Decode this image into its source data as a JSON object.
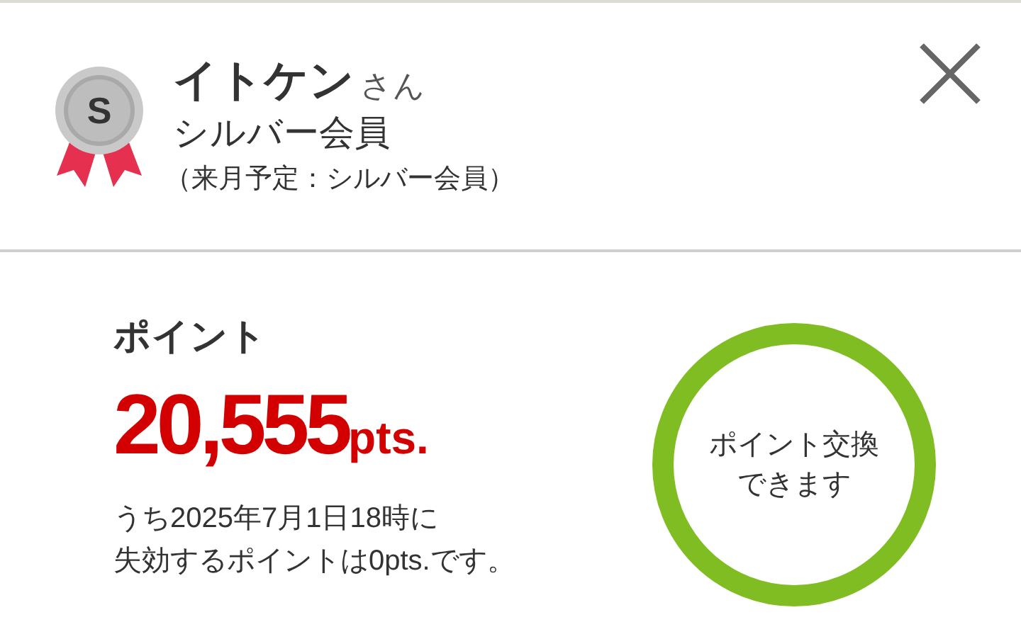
{
  "member": {
    "badge_letter": "S",
    "name": "イトケン",
    "honorific": "さん",
    "rank": "シルバー会員",
    "next_rank_note": "（来月予定：シルバー会員）"
  },
  "points": {
    "label": "ポイント",
    "value": "20,555",
    "unit": "pts.",
    "expiry_lines": [
      "うち2025年7月1日18時に",
      "失効するポイントは0pts.です。"
    ]
  },
  "exchange_button": {
    "label_lines": [
      "ポイント交換",
      "できます"
    ]
  }
}
